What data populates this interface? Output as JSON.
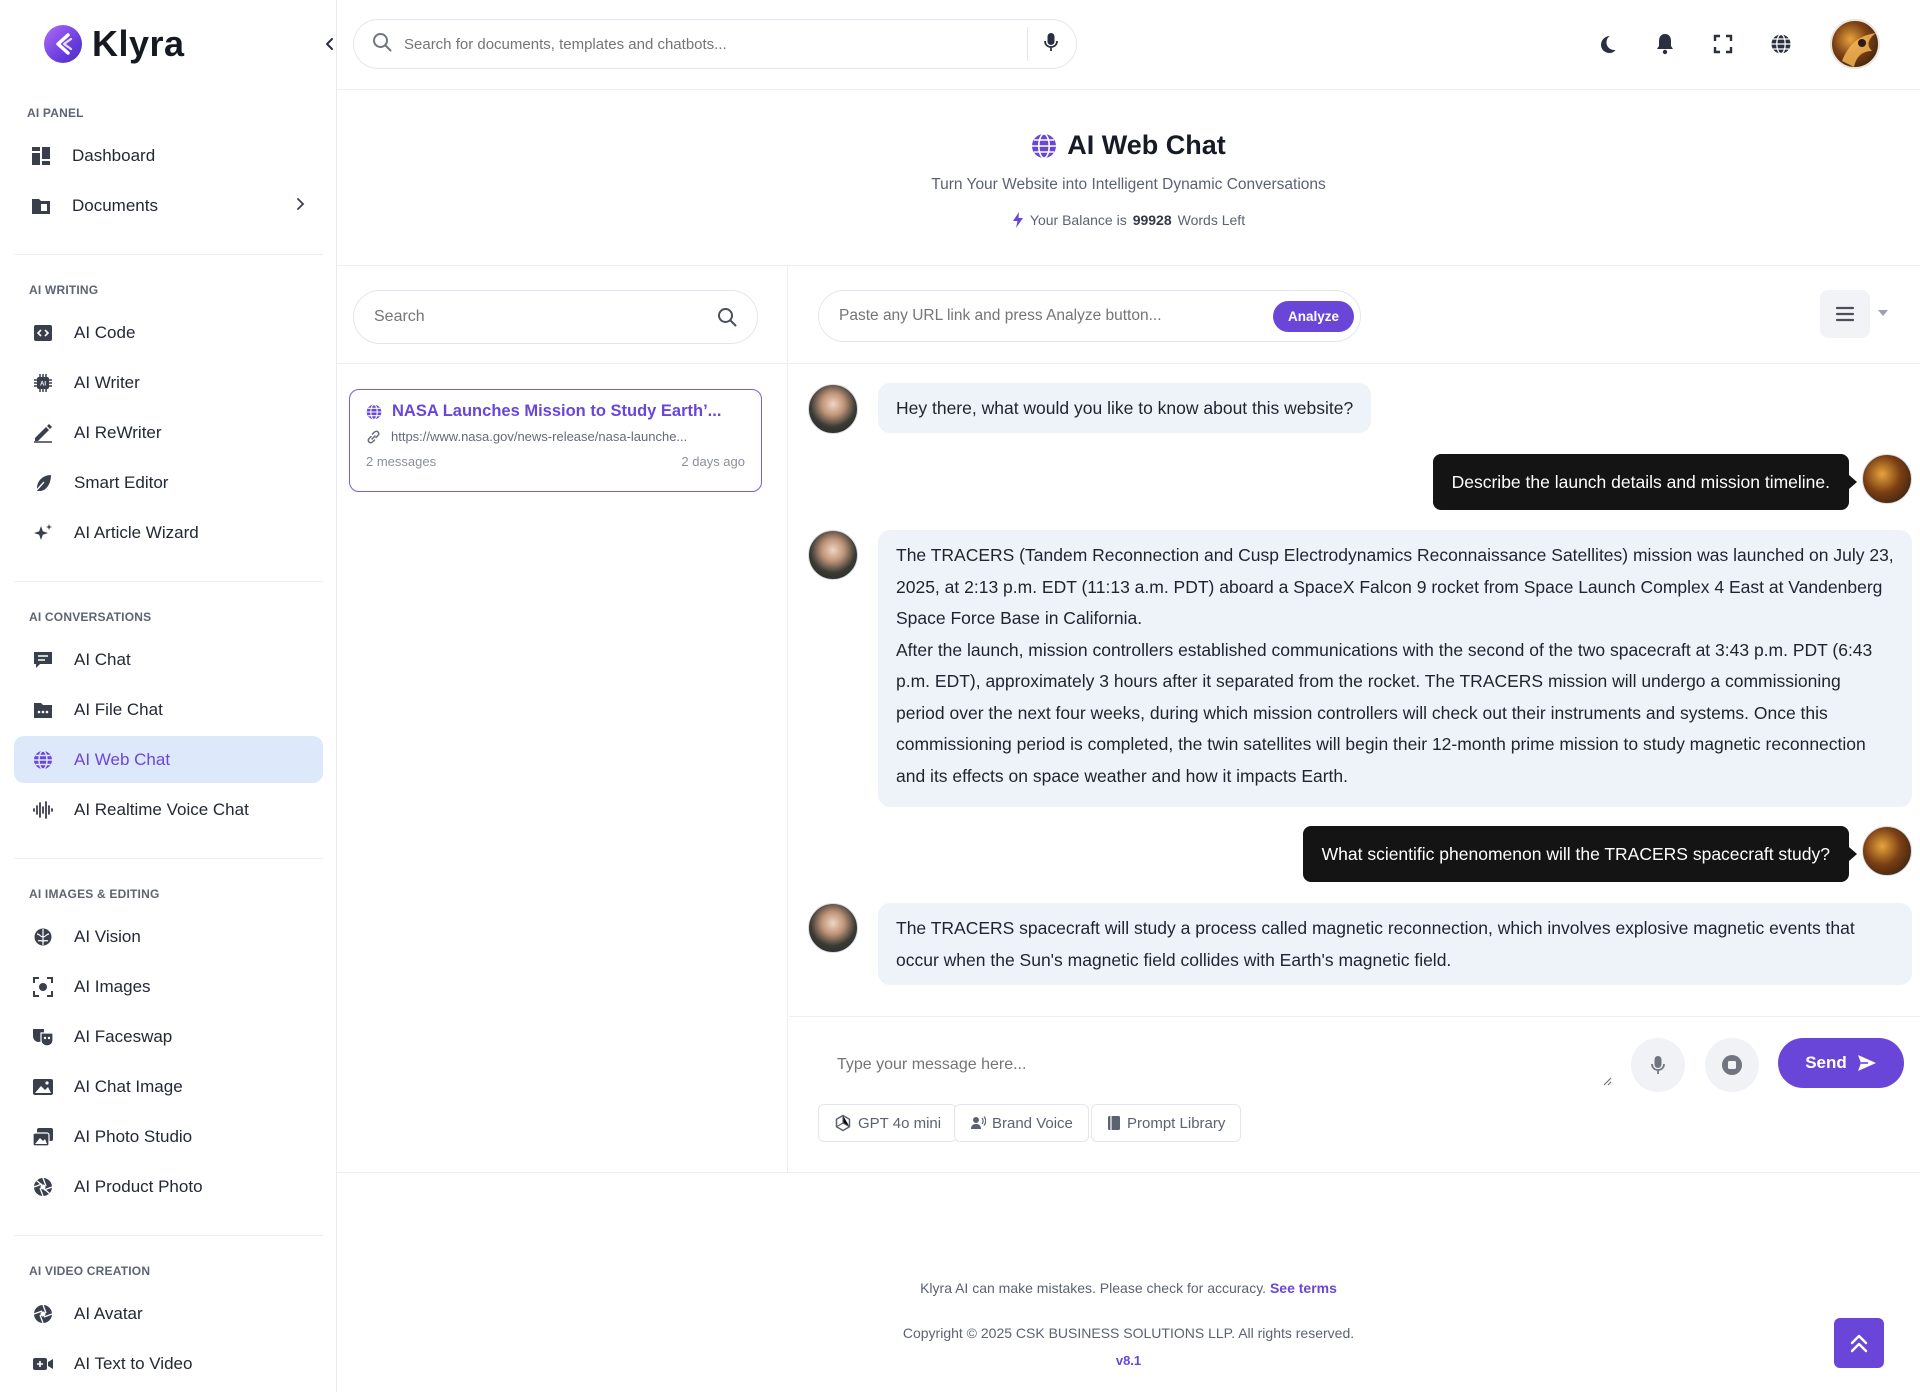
{
  "brand": {
    "name": "Klyra"
  },
  "search": {
    "placeholder": "Search for documents, templates and chatbots..."
  },
  "sidebar": {
    "sections": [
      {
        "title": "AI PANEL",
        "items": [
          {
            "label": "Dashboard",
            "icon": "dashboard-icon"
          },
          {
            "label": "Documents",
            "icon": "folder-icon",
            "has_submenu": true
          }
        ]
      },
      {
        "title": "AI WRITING",
        "items": [
          {
            "label": "AI Code",
            "icon": "code-icon"
          },
          {
            "label": "AI Writer",
            "icon": "chip-icon"
          },
          {
            "label": "AI ReWriter",
            "icon": "pen-icon"
          },
          {
            "label": "Smart Editor",
            "icon": "feather-icon"
          },
          {
            "label": "AI Article Wizard",
            "icon": "sparkles-icon"
          }
        ]
      },
      {
        "title": "AI CONVERSATIONS",
        "items": [
          {
            "label": "AI Chat",
            "icon": "chat-icon"
          },
          {
            "label": "AI File Chat",
            "icon": "file-chat-icon"
          },
          {
            "label": "AI Web Chat",
            "icon": "globe-icon",
            "active": true
          },
          {
            "label": "AI Realtime Voice Chat",
            "icon": "waveform-icon"
          }
        ]
      },
      {
        "title": "AI IMAGES & EDITING",
        "items": [
          {
            "label": "AI Vision",
            "icon": "brain-icon"
          },
          {
            "label": "AI Images",
            "icon": "scan-icon"
          },
          {
            "label": "AI Faceswap",
            "icon": "masks-icon"
          },
          {
            "label": "AI Chat Image",
            "icon": "image-icon"
          },
          {
            "label": "AI Photo Studio",
            "icon": "photos-icon"
          },
          {
            "label": "AI Product Photo",
            "icon": "aperture-icon"
          }
        ]
      },
      {
        "title": "AI VIDEO CREATION",
        "items": [
          {
            "label": "AI Avatar",
            "icon": "aperture-icon"
          },
          {
            "label": "AI Text to Video",
            "icon": "video-icon"
          }
        ]
      }
    ]
  },
  "header": {
    "title": "AI Web Chat",
    "subtitle": "Turn Your Website into Intelligent Dynamic Conversations",
    "balance_prefix": "Your Balance is",
    "balance_value": "99928",
    "balance_suffix": "Words Left"
  },
  "list": {
    "search_placeholder": "Search",
    "conversations": [
      {
        "title": "NASA Launches Mission to Study Earth’...",
        "url": "https://www.nasa.gov/news-release/nasa-launche...",
        "messages": "2 messages",
        "time": "2 days ago"
      }
    ]
  },
  "chat": {
    "url_placeholder": "Paste any URL link and press Analyze button...",
    "analyze_label": "Analyze",
    "messages": [
      {
        "role": "bot",
        "text": "Hey there, what would you like to know about this website?"
      },
      {
        "role": "user",
        "text": "Describe the launch details and mission timeline."
      },
      {
        "role": "bot",
        "text": "The TRACERS (Tandem Reconnection and Cusp Electrodynamics Reconnaissance Satellites) mission was launched on July 23, 2025, at 2:13 p.m. EDT (11:13 a.m. PDT) aboard a SpaceX Falcon 9 rocket from Space Launch Complex 4 East at Vandenberg Space Force Base in California.",
        "text2": "After the launch, mission controllers established communications with the second of the two spacecraft at 3:43 p.m. PDT (6:43 p.m. EDT), approximately 3 hours after it separated from the rocket. The TRACERS mission will undergo a commissioning period over the next four weeks, during which mission controllers will check out their instruments and systems. Once this commissioning period is completed, the twin satellites will begin their 12-month prime mission to study magnetic reconnection and its effects on space weather and how it impacts Earth."
      },
      {
        "role": "user",
        "text": "What scientific phenomenon will the TRACERS spacecraft study?"
      },
      {
        "role": "bot",
        "text": "The TRACERS spacecraft will study a process called magnetic reconnection, which involves explosive magnetic events that occur when the Sun's magnetic field collides with Earth's magnetic field."
      }
    ],
    "compose_placeholder": "Type your message here...",
    "send_label": "Send",
    "chips": {
      "model": "GPT 4o mini",
      "brand_voice": "Brand Voice",
      "prompt_library": "Prompt Library"
    }
  },
  "footer": {
    "disclaimer": "Klyra AI can make mistakes. Please check for accuracy.",
    "terms_link": "See terms",
    "copyright": "Copyright © 2025 CSK BUSINESS SOLUTIONS LLP. All rights reserved.",
    "version": "v8.1"
  },
  "colors": {
    "accent": "#6a46d8",
    "active_bg": "#dde9fb",
    "user_bubble": "#141414",
    "bot_bubble": "#eef3f9"
  }
}
